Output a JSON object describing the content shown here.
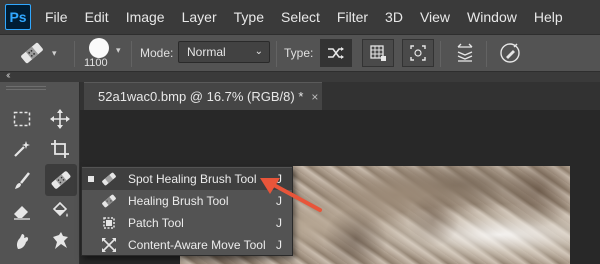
{
  "app": {
    "logo": "Ps"
  },
  "menubar": {
    "items": [
      {
        "label": "File"
      },
      {
        "label": "Edit"
      },
      {
        "label": "Image"
      },
      {
        "label": "Layer"
      },
      {
        "label": "Type"
      },
      {
        "label": "Select"
      },
      {
        "label": "Filter"
      },
      {
        "label": "3D"
      },
      {
        "label": "View"
      },
      {
        "label": "Window"
      },
      {
        "label": "Help"
      }
    ]
  },
  "options": {
    "brush_size": "1100",
    "mode_label": "Mode:",
    "mode_value": "Normal",
    "type_label": "Type:",
    "type_buttons": [
      {
        "icon": "proximity-match-icon",
        "active": true
      },
      {
        "icon": "create-texture-icon",
        "active": false
      },
      {
        "icon": "content-aware-icon",
        "active": false
      }
    ]
  },
  "document": {
    "tab_title": "52a1wac0.bmp @ 16.7% (RGB/8) *",
    "close_glyph": "×"
  },
  "flyout": {
    "items": [
      {
        "label": "Spot Healing Brush Tool",
        "key": "J",
        "selected": true,
        "icon": "spot-healing-brush-icon"
      },
      {
        "label": "Healing Brush Tool",
        "key": "J",
        "selected": false,
        "icon": "healing-brush-icon"
      },
      {
        "label": "Patch Tool",
        "key": "J",
        "selected": false,
        "icon": "patch-icon"
      },
      {
        "label": "Content-Aware Move Tool",
        "key": "J",
        "selected": false,
        "icon": "content-aware-move-icon"
      }
    ]
  },
  "colors": {
    "accent_arrow": "#e8553a",
    "ps_blue": "#31a8ff",
    "ps_navy": "#001d34"
  }
}
